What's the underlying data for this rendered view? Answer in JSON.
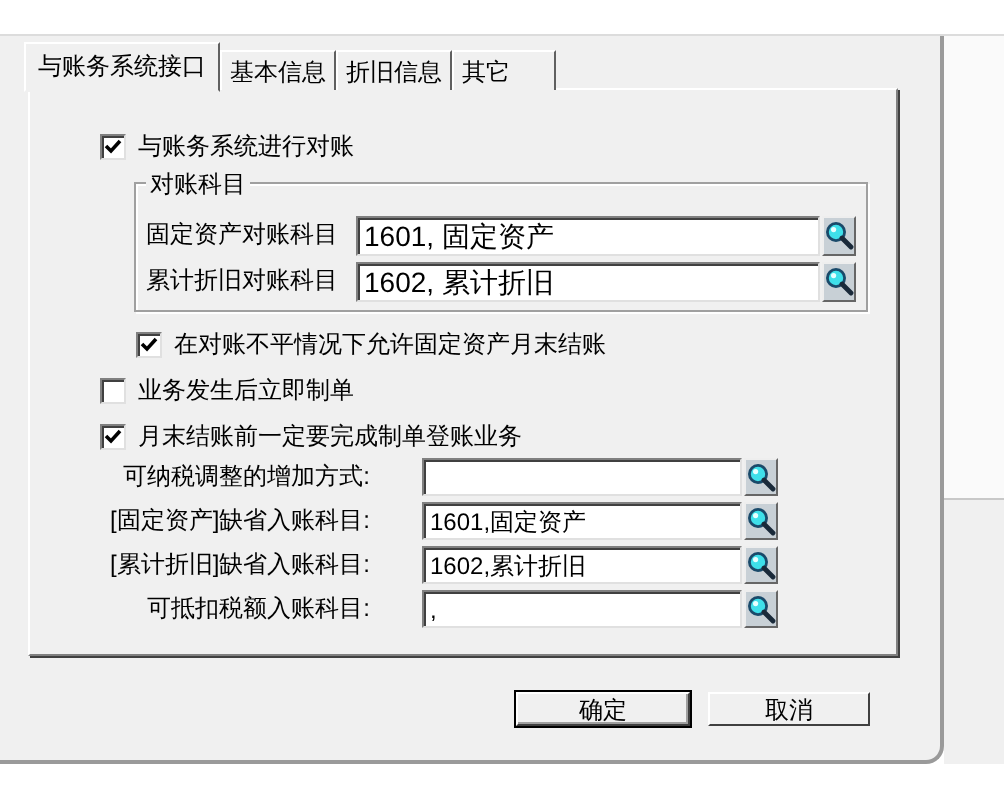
{
  "tabs": [
    {
      "label": "与账务系统接口",
      "selected": true
    },
    {
      "label": "基本信息",
      "selected": false
    },
    {
      "label": "折旧信息",
      "selected": false
    },
    {
      "label": "其它",
      "selected": false
    }
  ],
  "reconcile": {
    "label": "与账务系统进行对账",
    "checked": true
  },
  "group": {
    "title": "对账科目",
    "rows": [
      {
        "label": "固定资产对账科目",
        "value": "1601, 固定资产"
      },
      {
        "label": "累计折旧对账科目",
        "value": "1602, 累计折旧"
      }
    ]
  },
  "allow_close": {
    "label": "在对账不平情况下允许固定资产月末结账",
    "checked": true
  },
  "options": [
    {
      "label": "业务发生后立即制单",
      "checked": false
    },
    {
      "label": "月末结账前一定要完成制单登账业务",
      "checked": true
    }
  ],
  "fields": [
    {
      "label": "可纳税调整的增加方式:"
    },
    {
      "label": "[固定资产]缺省入账科目:",
      "value": "1601,固定资产"
    },
    {
      "label": "[累计折旧]缺省入账科目:",
      "value": "1602,累计折旧"
    },
    {
      "label": "可抵扣税额入账科目:",
      "value": ","
    }
  ],
  "buttons": [
    "确定",
    "取消"
  ]
}
